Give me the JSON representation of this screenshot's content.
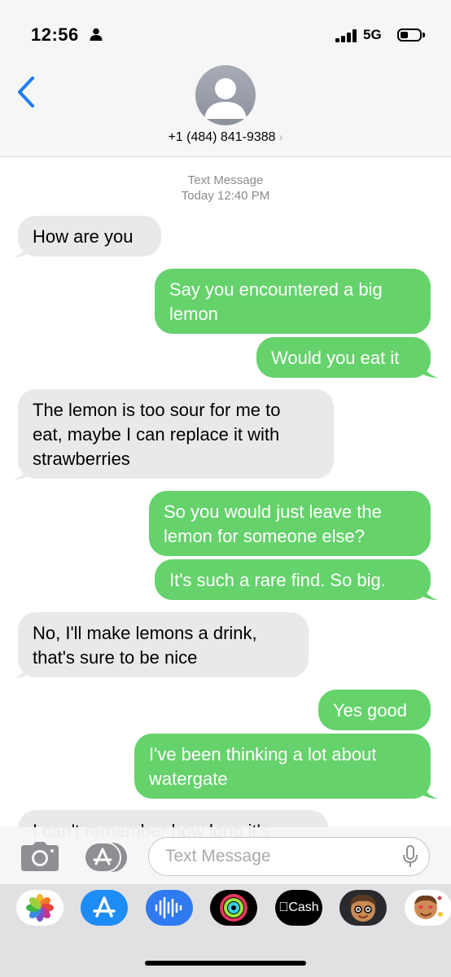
{
  "status_bar": {
    "time": "12:56",
    "network": "5G"
  },
  "header": {
    "contact": "+1 (484) 841-9388",
    "chevron": "›"
  },
  "thread": {
    "service_label": "Text Message",
    "timestamp": "Today 12:40 PM",
    "messages": [
      {
        "dir": "in",
        "text": "How are you"
      },
      {
        "dir": "out",
        "text": "Say you encountered a big\nlemon"
      },
      {
        "dir": "out",
        "text": "Would you eat it"
      },
      {
        "dir": "in",
        "text": "The lemon is too sour for me to\neat, maybe I can replace it with\nstrawberries"
      },
      {
        "dir": "out",
        "text": "So you would just leave the\nlemon for someone else?"
      },
      {
        "dir": "out",
        "text": "It's such a rare find. So big."
      },
      {
        "dir": "in",
        "text": "No, I'll make lemons a drink,\nthat's sure to be nice"
      },
      {
        "dir": "out",
        "text": "Yes good"
      },
      {
        "dir": "out",
        "text": "I've been thinking a lot about\nwatergate"
      },
      {
        "dir": "in",
        "text": "I can't remember how long it's"
      }
    ]
  },
  "composer": {
    "placeholder": "Text Message"
  },
  "app_drawer": {
    "apps": [
      "photos-icon",
      "app-store-icon",
      "audio-icon",
      "activity-icon",
      "cash-icon",
      "memoji-icon",
      "memoji-stickers-icon"
    ],
    "cash_label": "Cash"
  },
  "colors": {
    "outgoing": "#65d26b",
    "incoming": "#e9e9eb",
    "accent": "#1e7cf2"
  }
}
